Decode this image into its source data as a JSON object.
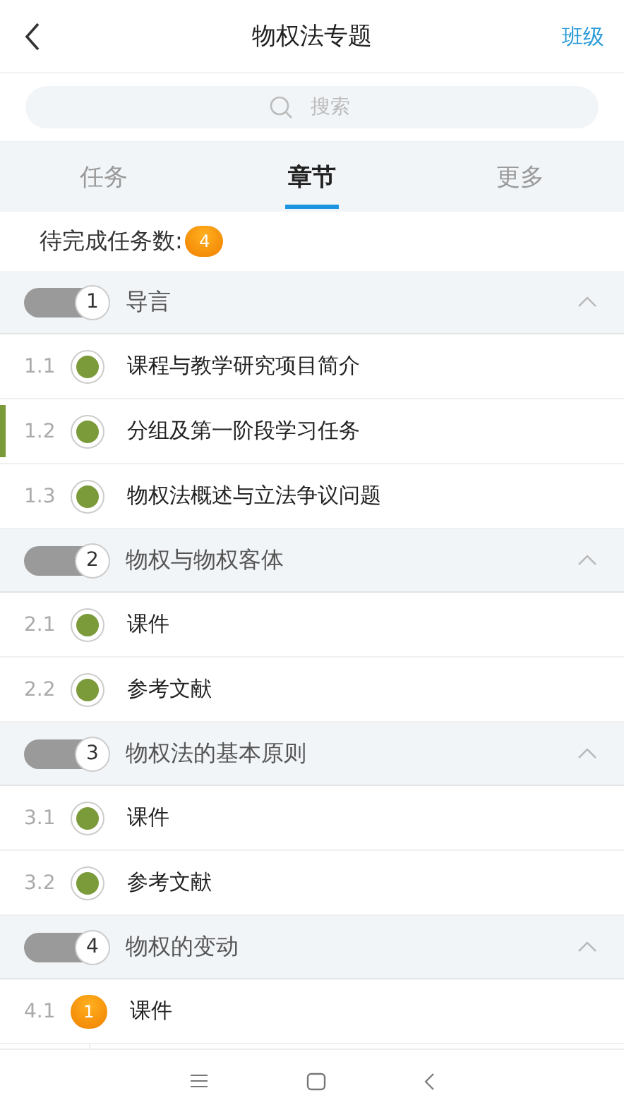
{
  "header": {
    "title": "物权法专题",
    "action": "班级"
  },
  "search": {
    "placeholder": "搜索"
  },
  "tabs": [
    {
      "label": "任务",
      "selected": false
    },
    {
      "label": "章节",
      "selected": true
    },
    {
      "label": "更多",
      "selected": false
    }
  ],
  "pending": {
    "label": "待完成任务数:",
    "count": "4"
  },
  "chapters": [
    {
      "number": "1",
      "title": "导言",
      "expanded": true,
      "items": [
        {
          "index": "1.1",
          "title": "课程与教学研究项目简介",
          "kind": "done",
          "selected": false
        },
        {
          "index": "1.2",
          "title": "分组及第一阶段学习任务",
          "kind": "done",
          "selected": true
        },
        {
          "index": "1.3",
          "title": "物权法概述与立法争议问题",
          "kind": "done",
          "selected": false
        }
      ]
    },
    {
      "number": "2",
      "title": "物权与物权客体",
      "expanded": true,
      "items": [
        {
          "index": "2.1",
          "title": "课件",
          "kind": "done",
          "selected": false
        },
        {
          "index": "2.2",
          "title": "参考文献",
          "kind": "done",
          "selected": false
        }
      ]
    },
    {
      "number": "3",
      "title": "物权法的基本原则",
      "expanded": true,
      "items": [
        {
          "index": "3.1",
          "title": "课件",
          "kind": "done",
          "selected": false
        },
        {
          "index": "3.2",
          "title": "参考文献",
          "kind": "done",
          "selected": false
        }
      ]
    },
    {
      "number": "4",
      "title": "物权的变动",
      "expanded": true,
      "items": [
        {
          "index": "4.1",
          "title": "课件",
          "kind": "pending",
          "count": "1",
          "selected": false
        }
      ]
    }
  ]
}
